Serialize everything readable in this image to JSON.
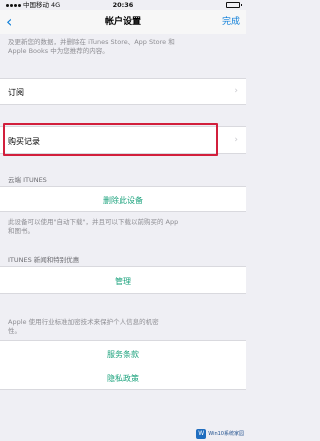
{
  "status_bar": {
    "carrier": "中国移动",
    "network": "4G",
    "time": "20:36"
  },
  "nav_bar": {
    "back_icon": "chevron-left-icon",
    "title": "帐户设置",
    "done_label": "完成"
  },
  "top_note": {
    "line1": "及更新您的数据，并删除在 iTunes Store、App Store 和",
    "line2": "Apple Books 中为您推荐的内容。"
  },
  "cells": {
    "subscriptions_label": "订阅",
    "purchase_history_label": "购买记录"
  },
  "cloud_section": {
    "header": "云端 ITUNES",
    "hide_devices_label": "删除此设备",
    "footer_line1": "此设备可以使用\"自动下载\"，并且可以下载以前购买的 App",
    "footer_line2": "和图书。"
  },
  "news_section": {
    "header": "ITUNES 新闻和特别优惠",
    "manage_label": "管理",
    "footer_line1": "Apple 使用行业标准加密技术来保护个人信息的机密",
    "footer_line2": "性。"
  },
  "links": {
    "terms_label": "服务条款",
    "privacy_label": "隐私政策"
  },
  "watermark": {
    "logo_text": "W",
    "title": "Win10系统家园",
    "subtitle": ""
  },
  "colors": {
    "accent_blue": "#0b7dd8",
    "link_green": "#1aa27c",
    "highlight_red": "#d21f3c"
  }
}
